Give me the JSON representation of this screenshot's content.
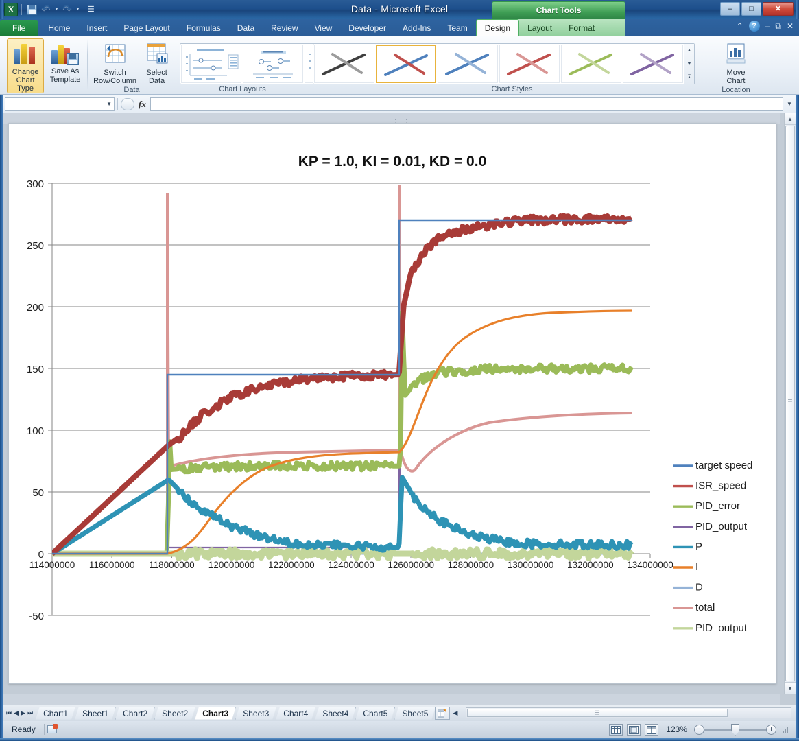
{
  "window": {
    "title": "Data  -  Microsoft Excel",
    "context_tools_label": "Chart Tools",
    "minimize": "–",
    "maximize": "□",
    "close": "✕"
  },
  "quick_access": {
    "logo": "X",
    "save": "save-icon",
    "undo": "↶",
    "redo": "↷",
    "customize": "☰"
  },
  "help_bar": {
    "collapse_ribbon": "⌃",
    "help": "?",
    "restore_down_1": "–",
    "restore_down_2": "⧉",
    "close_window": "✕"
  },
  "tabs": [
    {
      "label": "File"
    },
    {
      "label": "Home"
    },
    {
      "label": "Insert"
    },
    {
      "label": "Page Layout"
    },
    {
      "label": "Formulas"
    },
    {
      "label": "Data"
    },
    {
      "label": "Review"
    },
    {
      "label": "View"
    },
    {
      "label": "Developer"
    },
    {
      "label": "Add-Ins"
    },
    {
      "label": "Team"
    }
  ],
  "context_tabs": [
    {
      "label": "Design",
      "active": true
    },
    {
      "label": "Layout",
      "active": false
    },
    {
      "label": "Format",
      "active": false
    }
  ],
  "ribbon": {
    "groups": [
      {
        "name": "Type",
        "label": "Type",
        "buttons": [
          {
            "label": "Change\nChart Type",
            "line1": "Change",
            "line2": "Chart Type",
            "selected": true
          },
          {
            "label": "Save As\nTemplate",
            "line1": "Save As",
            "line2": "Template",
            "selected": false
          }
        ]
      },
      {
        "name": "Data",
        "label": "Data",
        "buttons": [
          {
            "line1": "Switch",
            "line2": "Row/Column",
            "selected": false
          },
          {
            "line1": "Select",
            "line2": "Data",
            "selected": false
          }
        ]
      },
      {
        "name": "Chart Layouts",
        "label": "Chart Layouts"
      },
      {
        "name": "Chart Styles",
        "label": "Chart Styles",
        "selected_index": 1
      },
      {
        "name": "Location",
        "label": "Location",
        "buttons": [
          {
            "line1": "Move",
            "line2": "Chart",
            "selected": false
          }
        ]
      }
    ],
    "style_colors": [
      "#808080",
      "#c0504d",
      "#4f81bd",
      "#c0504d",
      "#9bbb59",
      "#8064a2"
    ],
    "style_colors_b": [
      "#404040",
      "#4f81bd",
      "#95b3d7",
      "#d99694",
      "#c3d69b",
      "#b2a2c7"
    ]
  },
  "formula_bar": {
    "name_box_value": "",
    "formula_value": "",
    "fx_label": "fx",
    "dropdown": "▼"
  },
  "chart_data": {
    "type": "line",
    "title": "KP = 1.0, KI = 0.01, KD = 0.0",
    "xlabel": "",
    "ylabel": "",
    "xlim": [
      114000000,
      134000000
    ],
    "ylim": [
      -50,
      300
    ],
    "grid": true,
    "legend_position": "right",
    "x_ticks": [
      114000000,
      116000000,
      118000000,
      120000000,
      122000000,
      124000000,
      126000000,
      128000000,
      130000000,
      132000000,
      134000000
    ],
    "x_tick_labels": [
      "114000000",
      "116000000",
      "118000000",
      "120000000",
      "122000000",
      "124000000",
      "126000000",
      "128000000",
      "130000000",
      "132000000",
      "134000000"
    ],
    "y_ticks": [
      -50,
      0,
      50,
      100,
      150,
      200,
      250,
      300
    ],
    "y_tick_labels": [
      "-50",
      "0",
      "50",
      "100",
      "150",
      "200",
      "250",
      "300"
    ],
    "series": [
      {
        "name": "target speed",
        "color": "#4f81bd",
        "description": "step: 0 until 117.9M, 145 until 125.7M, 270 after",
        "steps": [
          {
            "x": 114000000,
            "y": 0
          },
          {
            "x": 117900000,
            "y": 145
          },
          {
            "x": 125700000,
            "y": 270
          },
          {
            "x": 133400000,
            "y": 270
          }
        ]
      },
      {
        "name": "ISR_speed",
        "color": "#c0504d",
        "description": "noisy first-order rise toward each target, dips at step onset",
        "points": [
          [
            114000000,
            0
          ],
          [
            117900000,
            88
          ],
          [
            118300000,
            95
          ],
          [
            119000000,
            112
          ],
          [
            120000000,
            127
          ],
          [
            121000000,
            135
          ],
          [
            122000000,
            140
          ],
          [
            123000000,
            143
          ],
          [
            124000000,
            144
          ],
          [
            125600000,
            145
          ],
          [
            125750000,
            200
          ],
          [
            126000000,
            228
          ],
          [
            126500000,
            247
          ],
          [
            127000000,
            256
          ],
          [
            128000000,
            264
          ],
          [
            129000000,
            268
          ],
          [
            130000000,
            270
          ],
          [
            132000000,
            271
          ],
          [
            133400000,
            271
          ]
        ]
      },
      {
        "name": "PID_error",
        "color": "#9bbb59",
        "description": "spike at step then settles around 70 then 150",
        "points": [
          [
            114000000,
            0
          ],
          [
            117880000,
            0
          ],
          [
            117900000,
            148
          ],
          [
            117950000,
            68
          ],
          [
            119000000,
            70
          ],
          [
            121000000,
            71
          ],
          [
            124000000,
            71
          ],
          [
            125650000,
            71
          ],
          [
            125700000,
            200
          ],
          [
            125800000,
            128
          ],
          [
            126200000,
            140
          ],
          [
            127000000,
            147
          ],
          [
            129000000,
            150
          ],
          [
            133400000,
            150
          ]
        ]
      },
      {
        "name": "PID_output",
        "color": "#8064a2",
        "description": "hidden behind other series, near zero baseline",
        "points": [
          [
            114000000,
            0
          ],
          [
            133400000,
            0
          ]
        ]
      },
      {
        "name": "P",
        "color": "#2e93b5",
        "description": "proportional term: decays from 60 toward ~5 after each step",
        "points": [
          [
            114000000,
            0
          ],
          [
            117900000,
            60
          ],
          [
            118500000,
            45
          ],
          [
            119000000,
            36
          ],
          [
            120000000,
            22
          ],
          [
            121000000,
            14
          ],
          [
            122000000,
            9
          ],
          [
            123000000,
            7
          ],
          [
            125600000,
            5
          ],
          [
            125700000,
            62
          ],
          [
            126200000,
            42
          ],
          [
            127000000,
            26
          ],
          [
            128000000,
            15
          ],
          [
            129000000,
            10
          ],
          [
            130000000,
            8
          ],
          [
            133400000,
            7
          ]
        ]
      },
      {
        "name": "I",
        "color": "#e8802a",
        "description": "integral term: ramps up to ~70 then to ~150",
        "points": [
          [
            114000000,
            0
          ],
          [
            117900000,
            0
          ],
          [
            119000000,
            28
          ],
          [
            120000000,
            48
          ],
          [
            121000000,
            60
          ],
          [
            122000000,
            66
          ],
          [
            123000000,
            69
          ],
          [
            125600000,
            70
          ],
          [
            126000000,
            88
          ],
          [
            126500000,
            118
          ],
          [
            127000000,
            134
          ],
          [
            128000000,
            145
          ],
          [
            130000000,
            149
          ],
          [
            133400000,
            150
          ]
        ]
      },
      {
        "name": "D",
        "color": "#95b3d7",
        "description": "derivative term: flat at 0",
        "points": [
          [
            114000000,
            0
          ],
          [
            133400000,
            0
          ]
        ]
      },
      {
        "name": "total",
        "color": "#d99694",
        "description": "sum of P+I+D, tracks just above PID_error band",
        "points": [
          [
            114000000,
            0
          ],
          [
            117900000,
            72
          ],
          [
            120000000,
            72
          ],
          [
            124000000,
            72
          ],
          [
            125700000,
            150
          ],
          [
            128000000,
            152
          ],
          [
            133400000,
            152
          ]
        ]
      },
      {
        "name": "PID_output",
        "color": "#c3d69b",
        "description": "clipped PID output, overlaps PID_error band",
        "points": [
          [
            114000000,
            0
          ],
          [
            117900000,
            148
          ],
          [
            118000000,
            66
          ],
          [
            120000000,
            70
          ],
          [
            124000000,
            71
          ],
          [
            125700000,
            200
          ],
          [
            125900000,
            128
          ],
          [
            127000000,
            146
          ],
          [
            130000000,
            150
          ],
          [
            133400000,
            150
          ]
        ]
      }
    ],
    "legend_entries": [
      {
        "label": "target speed",
        "color": "#4f81bd"
      },
      {
        "label": "ISR_speed",
        "color": "#c0504d"
      },
      {
        "label": "PID_error",
        "color": "#9bbb59"
      },
      {
        "label": "PID_output",
        "color": "#8064a2"
      },
      {
        "label": "P",
        "color": "#2e93b5"
      },
      {
        "label": "I",
        "color": "#e8802a"
      },
      {
        "label": "D",
        "color": "#95b3d7"
      },
      {
        "label": "total",
        "color": "#d99694"
      },
      {
        "label": "PID_output",
        "color": "#c3d69b"
      }
    ]
  },
  "sheet_tabs": {
    "nav": {
      "first": "⏮",
      "prev": "◀",
      "next": "▶",
      "last": "⏭"
    },
    "items": [
      {
        "label": "Chart1",
        "active": false
      },
      {
        "label": "Sheet1",
        "active": false
      },
      {
        "label": "Chart2",
        "active": false
      },
      {
        "label": "Sheet2",
        "active": false
      },
      {
        "label": "Chart3",
        "active": true
      },
      {
        "label": "Sheet3",
        "active": false
      },
      {
        "label": "Chart4",
        "active": false
      },
      {
        "label": "Sheet4",
        "active": false
      },
      {
        "label": "Chart5",
        "active": false
      },
      {
        "label": "Sheet5",
        "active": false
      }
    ],
    "insert_sheet": "insert-worksheet-icon",
    "scroll_right": "◀"
  },
  "status_bar": {
    "status": "Ready",
    "macro_record": "record-macro-icon",
    "views": [
      "normal-view",
      "page-layout-view",
      "page-break-view"
    ],
    "zoom_level": "123%",
    "zoom_out": "−",
    "zoom_in": "+"
  }
}
